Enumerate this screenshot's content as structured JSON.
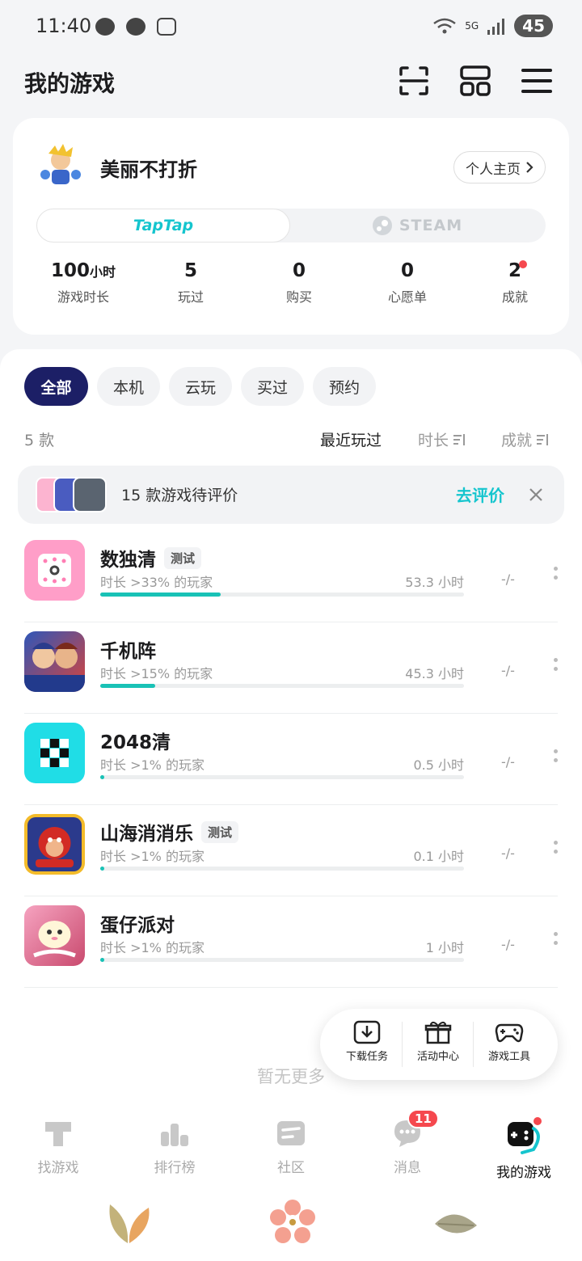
{
  "status_bar": {
    "time": "11:40",
    "network": "5G",
    "battery": "45"
  },
  "header": {
    "title": "我的游戏"
  },
  "profile": {
    "username": "美丽不打折",
    "home_button": "个人主页",
    "platforms": [
      "TapTap",
      "STEAM"
    ],
    "stats": [
      {
        "value": "100",
        "unit": "小时",
        "label": "游戏时长"
      },
      {
        "value": "5",
        "label": "玩过"
      },
      {
        "value": "0",
        "label": "购买"
      },
      {
        "value": "0",
        "label": "心愿单"
      },
      {
        "value": "2",
        "label": "成就"
      }
    ]
  },
  "filters": [
    "全部",
    "本机",
    "云玩",
    "买过",
    "预约"
  ],
  "list_header": {
    "count": "5 款",
    "sort_recent": "最近玩过",
    "sort_duration": "时长",
    "sort_achievement": "成就"
  },
  "review_banner": {
    "text": "15 款游戏待评价",
    "action": "去评价"
  },
  "games": [
    {
      "name": "数独清",
      "tag": "测试",
      "subtitle": "时长 >33% 的玩家",
      "hours": "53.3 小时",
      "achievement": "-/-",
      "progress": 0.33
    },
    {
      "name": "千机阵",
      "tag": "",
      "subtitle": "时长 >15% 的玩家",
      "hours": "45.3 小时",
      "achievement": "-/-",
      "progress": 0.15
    },
    {
      "name": "2048清",
      "tag": "",
      "subtitle": "时长 >1% 的玩家",
      "hours": "0.5 小时",
      "achievement": "-/-",
      "progress": 0.01
    },
    {
      "name": "山海消消乐",
      "tag": "测试",
      "subtitle": "时长 >1% 的玩家",
      "hours": "0.1 小时",
      "achievement": "-/-",
      "progress": 0.01
    },
    {
      "name": "蛋仔派对",
      "tag": "",
      "subtitle": "时长 >1% 的玩家",
      "hours": "1 小时",
      "achievement": "-/-",
      "progress": 0.01
    }
  ],
  "no_more": "暂无更多",
  "float_toolbar": [
    "下载任务",
    "活动中心",
    "游戏工具"
  ],
  "bottom_nav": [
    {
      "label": "找游戏"
    },
    {
      "label": "排行榜"
    },
    {
      "label": "社区"
    },
    {
      "label": "消息",
      "badge": "11"
    },
    {
      "label": "我的游戏"
    }
  ],
  "colors": {
    "accent": "#15c5ce",
    "filter_active": "#1c1f66",
    "progress": "#19c2b6",
    "badge": "#f5484e"
  },
  "icons": [
    "scan-icon",
    "grid-icon",
    "menu-icon",
    "chevron-right-icon",
    "close-icon",
    "download-icon",
    "gift-icon",
    "gamepad-icon",
    "more-icon"
  ]
}
